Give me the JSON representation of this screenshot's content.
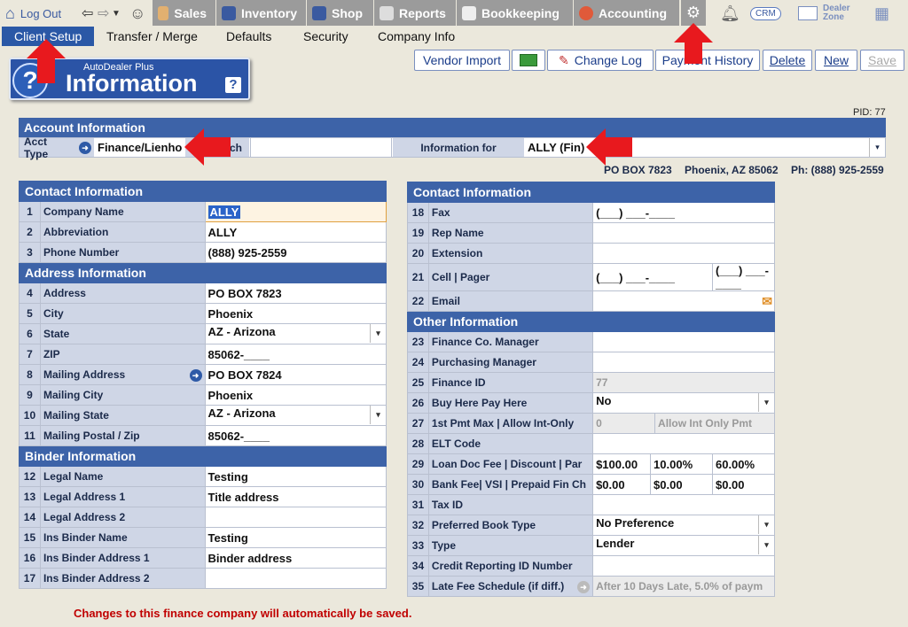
{
  "nav": {
    "logout": "Log Out",
    "tabs": [
      "Sales",
      "Inventory",
      "Shop",
      "Reports",
      "Bookkeeping",
      "Accounting"
    ],
    "crm": "CRM",
    "dealer_zone": "Dealer Zone"
  },
  "subnav": [
    "Client Setup",
    "Transfer / Merge",
    "Defaults",
    "Security",
    "Company Info"
  ],
  "badge": {
    "small": "AutoDealer Plus",
    "big": "Information",
    "help": "?"
  },
  "buttons": {
    "vendor_import": "Vendor Import",
    "change_log": "Change Log",
    "payment_history": "Payment History",
    "delete": "Delete",
    "new": "New",
    "save": "Save"
  },
  "pid": "PID: 77",
  "account": {
    "header": "Account Information",
    "acct_type_label": "Acct Type",
    "acct_type_value": "Finance/Lienho",
    "search_label": "rch",
    "info_for_label": "Information for",
    "info_for_value": "ALLY  (Fin)"
  },
  "address_line": {
    "box": "PO BOX 7823",
    "city": "Phoenix, AZ 85062",
    "phone": "Ph: (888) 925-2559"
  },
  "left": {
    "contact_header": "Contact Information",
    "address_header": "Address Information",
    "binder_header": "Binder Information",
    "rows": [
      {
        "n": "1",
        "label": "Company Name",
        "value": "ALLY"
      },
      {
        "n": "2",
        "label": "Abbreviation",
        "value": "ALLY"
      },
      {
        "n": "3",
        "label": "Phone Number",
        "value": "(888) 925-2559"
      },
      {
        "n": "4",
        "label": "Address",
        "value": "PO BOX 7823"
      },
      {
        "n": "5",
        "label": "City",
        "value": "Phoenix"
      },
      {
        "n": "6",
        "label": "State",
        "value": "AZ - Arizona"
      },
      {
        "n": "7",
        "label": "ZIP",
        "value": "85062-____"
      },
      {
        "n": "8",
        "label": "Mailing Address",
        "value": "PO BOX 7824"
      },
      {
        "n": "9",
        "label": "Mailing City",
        "value": "Phoenix"
      },
      {
        "n": "10",
        "label": "Mailing State",
        "value": "AZ - Arizona"
      },
      {
        "n": "11",
        "label": "Mailing Postal / Zip",
        "value": "85062-____"
      },
      {
        "n": "12",
        "label": "Legal Name",
        "value": "Testing"
      },
      {
        "n": "13",
        "label": "Legal Address 1",
        "value": "Title address"
      },
      {
        "n": "14",
        "label": "Legal Address 2",
        "value": ""
      },
      {
        "n": "15",
        "label": "Ins Binder Name",
        "value": "Testing"
      },
      {
        "n": "16",
        "label": "Ins Binder Address 1",
        "value": "Binder address"
      },
      {
        "n": "17",
        "label": "Ins Binder Address 2",
        "value": ""
      }
    ]
  },
  "right": {
    "contact_header": "Contact Information",
    "other_header": "Other Information",
    "rows": [
      {
        "n": "18",
        "label": "Fax",
        "value": "(___) ___-____"
      },
      {
        "n": "19",
        "label": "Rep Name",
        "value": ""
      },
      {
        "n": "20",
        "label": "Extension",
        "value": ""
      },
      {
        "n": "21",
        "label": "Cell | Pager",
        "value": "(___) ___-____",
        "value2": "(___) ___-____"
      },
      {
        "n": "22",
        "label": "Email",
        "value": ""
      },
      {
        "n": "23",
        "label": "Finance Co. Manager",
        "value": ""
      },
      {
        "n": "24",
        "label": "Purchasing Manager",
        "value": ""
      },
      {
        "n": "25",
        "label": "Finance ID",
        "value": "77"
      },
      {
        "n": "26",
        "label": "Buy Here Pay Here",
        "value": "No"
      },
      {
        "n": "27",
        "label": "1st Pmt Max | Allow Int-Only",
        "value": "0",
        "value2": "Allow Int Only Pmt"
      },
      {
        "n": "28",
        "label": "ELT Code",
        "value": ""
      },
      {
        "n": "29",
        "label": "Loan Doc Fee | Discount | Par",
        "value": "$100.00",
        "value2": "10.00%",
        "value3": "60.00%"
      },
      {
        "n": "30",
        "label": "Bank Fee| VSI | Prepaid Fin Ch",
        "value": "$0.00",
        "value2": "$0.00",
        "value3": "$0.00"
      },
      {
        "n": "31",
        "label": "Tax ID",
        "value": ""
      },
      {
        "n": "32",
        "label": "Preferred Book Type",
        "value": "No Preference"
      },
      {
        "n": "33",
        "label": "Type",
        "value": "Lender"
      },
      {
        "n": "34",
        "label": "Credit Reporting ID Number",
        "value": ""
      },
      {
        "n": "35",
        "label": "Late Fee Schedule (if diff.)",
        "value": "After 10 Days Late, 5.0% of paym"
      }
    ]
  },
  "message": "Changes to this finance company will automatically be saved."
}
